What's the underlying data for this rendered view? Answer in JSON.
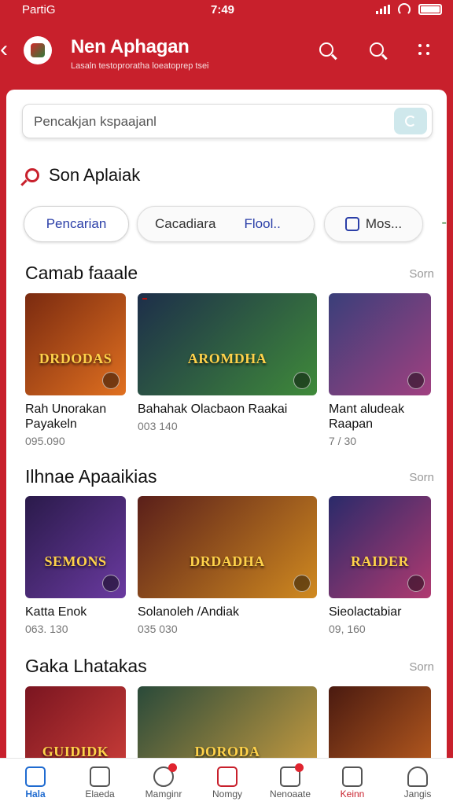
{
  "status": {
    "carrier": "PartiG",
    "time": "7:49"
  },
  "appbar": {
    "title": "Nen Aphagan",
    "subtitle": "Lasaln testoproratha loeatoprep tsei"
  },
  "search": {
    "value": "Pencakjan  kspaajanl"
  },
  "recommend": {
    "title": "Son Aplaiak"
  },
  "chips": [
    {
      "label": "Pencarian"
    },
    {
      "label": "Cacadiara"
    },
    {
      "label": "Flool.."
    },
    {
      "label": "Mos..."
    }
  ],
  "chips_more": "-",
  "sections": [
    {
      "title": "Camab faaale",
      "see_all": "Sorn",
      "cards": [
        {
          "name": "Rah Unorakan Payakeln",
          "meta": "095.090",
          "thumb_text": "DRDODAS",
          "colors": [
            "#7a2a10",
            "#e07020"
          ]
        },
        {
          "name": "Bahahak Olacbaon Raakai",
          "meta": "003 140",
          "thumb_text": "AROMDHA",
          "colors": [
            "#1d2e4a",
            "#3f8a3a"
          ]
        },
        {
          "name": "Mant aludeak Raapan",
          "meta": "7 / 30",
          "thumb_text": "",
          "colors": [
            "#3a3f7a",
            "#a04080"
          ]
        }
      ]
    },
    {
      "title": "Ilhnae Apaaikias",
      "see_all": "Sorn",
      "cards": [
        {
          "name": "Katta Enok",
          "meta": "063. 130",
          "thumb_text": "SEMONS",
          "colors": [
            "#2a1a4a",
            "#6a3aa0"
          ]
        },
        {
          "name": "Solanoleh /Andiak",
          "meta": "035 030",
          "thumb_text": "DRDADHA",
          "colors": [
            "#5a1f1a",
            "#d08a20"
          ]
        },
        {
          "name": "Sieolactabiar",
          "meta": "09, 160",
          "thumb_text": "RAIDER",
          "colors": [
            "#2a2a6a",
            "#b03a70"
          ]
        }
      ]
    },
    {
      "title": "Gaka Lhatakas",
      "see_all": "Sorn",
      "cards": [
        {
          "name": "",
          "meta": "",
          "thumb_text": "GUIDIDK",
          "colors": [
            "#7a1520",
            "#d0403a"
          ]
        },
        {
          "name": "",
          "meta": "",
          "thumb_text": "DORODA",
          "colors": [
            "#2a4a3a",
            "#d0a040"
          ]
        },
        {
          "name": "",
          "meta": "",
          "thumb_text": "",
          "colors": [
            "#4a1a10",
            "#c06020"
          ]
        }
      ]
    }
  ],
  "nav": [
    {
      "label": "Hala",
      "icon": "home-icon",
      "active": true
    },
    {
      "label": "Elaeda",
      "icon": "document-icon"
    },
    {
      "label": "Mamginr",
      "icon": "gamepad-icon",
      "badge": true
    },
    {
      "label": "Nomgy",
      "icon": "heart-icon"
    },
    {
      "label": "Nenoaate",
      "icon": "news-icon",
      "badge": true
    },
    {
      "label": "Keinn",
      "icon": "camera-icon",
      "highlight": true
    },
    {
      "label": "Jangis",
      "icon": "profile-icon"
    }
  ],
  "accent": "#c8202c"
}
